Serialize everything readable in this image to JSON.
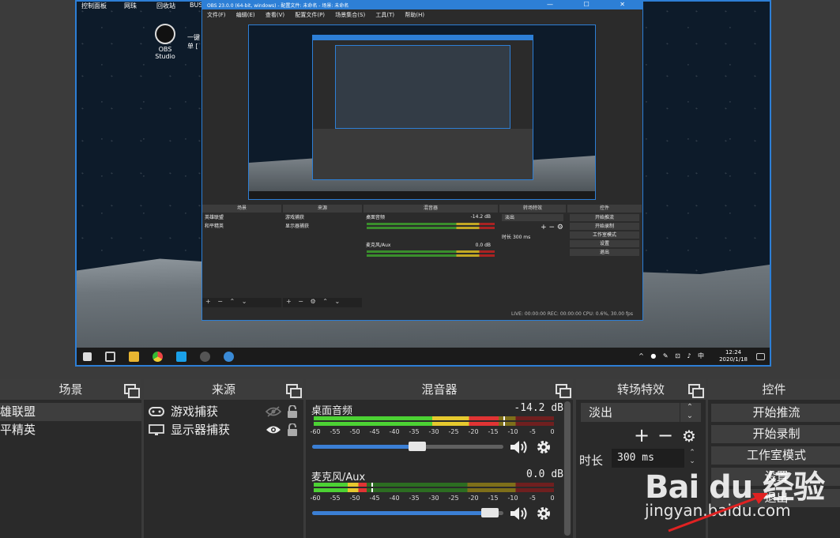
{
  "desktop": {
    "top_labels": [
      "控制面板",
      "网珠",
      "回收站",
      "BUS"
    ],
    "icon1_label": "OBS Studio",
    "icon2_label": "一键\n单 [",
    "clock_time": "12:24",
    "clock_date": "2020/1/18",
    "tray_text": "中"
  },
  "obs_window": {
    "title": "OBS 23.0.0 (64-bit, windows) - 配置文件: 未命名 - 场景: 未命名",
    "menu": [
      "文件(F)",
      "编辑(E)",
      "查看(V)",
      "配置文件(P)",
      "场景集合(S)",
      "工具(T)",
      "帮助(H)"
    ],
    "docks": {
      "scenes_title": "场景",
      "scenes": [
        "英雄联盟",
        "和平精英"
      ],
      "sources_title": "来源",
      "sources": [
        "游戏捕获",
        "显示器捕获"
      ],
      "mixer_title": "混音器",
      "mixer_ch1": "桌面音频",
      "mixer_ch1_db": "-14.2 dB",
      "mixer_ch2": "麦克风/Aux",
      "mixer_ch2_db": "0.0 dB",
      "trans_title": "转场特效",
      "trans_value": "淡出",
      "duration_label": "时长",
      "duration_value": "300 ms",
      "controls_title": "控件",
      "controls": [
        "开始推流",
        "开始录制",
        "工作室模式",
        "设置",
        "退出"
      ]
    },
    "status": "LIVE: 00:00:00   REC: 00:00:00   CPU: 0.6%, 30.00 fps"
  },
  "scenes": {
    "title": "场景",
    "items": [
      "雄联盟",
      "平精英"
    ]
  },
  "sources": {
    "title": "来源",
    "items": [
      "游戏捕获",
      "显示器捕获"
    ]
  },
  "mixer": {
    "title": "混音器",
    "ticks": [
      "-60",
      "-55",
      "-50",
      "-45",
      "-40",
      "-35",
      "-30",
      "-25",
      "-20",
      "-15",
      "-10",
      "-5",
      "0"
    ],
    "channels": [
      {
        "name": "桌面音频",
        "db": "-14.2 dB",
        "level_fraction": 0.77,
        "volume_fraction": 0.55
      },
      {
        "name": "麦克风/Aux",
        "db": "0.0 dB",
        "level_fraction": 0.22,
        "volume_fraction": 0.93
      }
    ]
  },
  "transitions": {
    "title": "转场特效",
    "selected": "淡出",
    "duration_label": "时长",
    "duration_value": "300 ms"
  },
  "controls": {
    "title": "控件",
    "buttons": [
      "开始推流",
      "开始录制",
      "工作室模式",
      "设置",
      "退出"
    ]
  },
  "watermark": {
    "logo": "Bai du 经验",
    "url": "jingyan.baidu.com"
  },
  "colors": {
    "accent": "#2d7fd6",
    "meter_green": "#4cd234",
    "meter_yellow": "#e6c92e",
    "meter_red": "#e03434",
    "dock_bg": "#2a2a2a",
    "dock_header": "#3c3c3c"
  },
  "icons": [
    "gamepad-icon",
    "monitor-icon",
    "eye-hidden-icon",
    "eye-icon",
    "lock-icon",
    "speaker-icon",
    "gear-icon",
    "float-dock-icon",
    "plus-icon",
    "minus-icon"
  ]
}
